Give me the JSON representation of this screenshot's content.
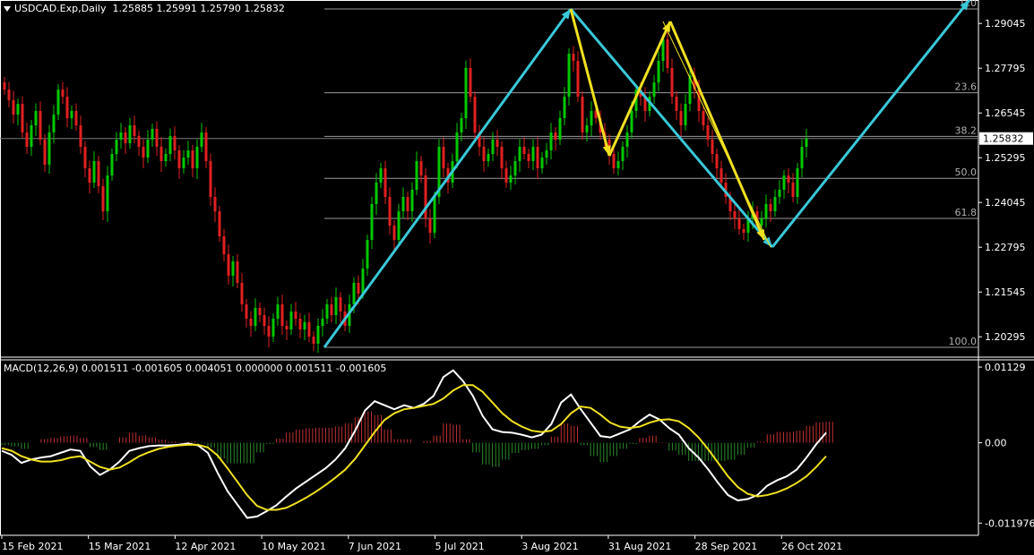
{
  "header": {
    "symbol": "USDCAD.Exp,Daily",
    "ohlc": "1.25885 1.25991 1.25790 1.25832"
  },
  "macd_header": "MACD(12,26,9) 0.001511 -0.001605 0.004051 0.000000 0.001511 -0.001605",
  "colors": {
    "background": "#000000",
    "bull_candle": "#00c800",
    "bear_candle": "#e02020",
    "fib_line": "#9a9a9a",
    "cyan_arrow": "#39c8d8",
    "yellow_arrow": "#f0e020",
    "macd_line": "#ffffff",
    "signal_line": "#f0e020",
    "hist_pos": "#c03030",
    "hist_neg": "#2a8a2a"
  },
  "chart_data": {
    "type": "candlestick",
    "price_ticks": [
      1.29045,
      1.27795,
      1.26545,
      1.25295,
      1.24045,
      1.22795,
      1.21545,
      1.20295
    ],
    "current_price": "1.25832",
    "ylim": [
      1.1975,
      1.2965
    ],
    "x_dates": [
      "15 Feb 2021",
      "15 Mar 2021",
      "12 Apr 2021",
      "10 May 2021",
      "7 Jun 2021",
      "5 Jul 2021",
      "3 Aug 2021",
      "31 Aug 2021",
      "28 Sep 2021",
      "26 Oct 2021"
    ],
    "fib_levels": [
      {
        "label": "0.0",
        "price": 1.2945
      },
      {
        "label": "23.6",
        "price": 1.2711
      },
      {
        "label": "38.2",
        "price": 1.2589
      },
      {
        "label": "50.0",
        "price": 1.2472
      },
      {
        "label": "61.8",
        "price": 1.236
      },
      {
        "label": "100.0",
        "price": 1.2
      }
    ],
    "close_series": [
      1.272,
      1.269,
      1.265,
      1.268,
      1.26,
      1.256,
      1.262,
      1.266,
      1.258,
      1.251,
      1.26,
      1.265,
      1.272,
      1.27,
      1.264,
      1.266,
      1.262,
      1.256,
      1.25,
      1.246,
      1.252,
      1.245,
      1.238,
      1.248,
      1.254,
      1.258,
      1.26,
      1.257,
      1.262,
      1.259,
      1.256,
      1.253,
      1.258,
      1.261,
      1.256,
      1.252,
      1.254,
      1.259,
      1.255,
      1.25,
      1.253,
      1.255,
      1.25,
      1.256,
      1.26,
      1.252,
      1.242,
      1.238,
      1.231,
      1.226,
      1.22,
      1.224,
      1.218,
      1.212,
      1.208,
      1.206,
      1.211,
      1.209,
      1.206,
      1.203,
      1.208,
      1.212,
      1.206,
      1.205,
      1.21,
      1.208,
      1.205,
      1.207,
      1.203,
      1.201,
      1.206,
      1.208,
      1.212,
      1.209,
      1.214,
      1.21,
      1.206,
      1.212,
      1.218,
      1.215,
      1.222,
      1.23,
      1.24,
      1.246,
      1.25,
      1.242,
      1.234,
      1.23,
      1.238,
      1.242,
      1.238,
      1.244,
      1.252,
      1.248,
      1.236,
      1.232,
      1.242,
      1.256,
      1.25,
      1.246,
      1.252,
      1.26,
      1.264,
      1.278,
      1.27,
      1.26,
      1.256,
      1.252,
      1.254,
      1.258,
      1.256,
      1.25,
      1.246,
      1.248,
      1.252,
      1.256,
      1.254,
      1.252,
      1.256,
      1.25,
      1.253,
      1.255,
      1.26,
      1.258,
      1.264,
      1.27,
      1.282,
      1.28,
      1.27,
      1.26,
      1.262,
      1.266,
      1.264,
      1.26,
      1.258,
      1.254,
      1.25,
      1.252,
      1.256,
      1.26,
      1.266,
      1.272,
      1.27,
      1.266,
      1.27,
      1.274,
      1.28,
      1.286,
      1.278,
      1.27,
      1.266,
      1.262,
      1.268,
      1.276,
      1.272,
      1.266,
      1.262,
      1.258,
      1.254,
      1.25,
      1.246,
      1.242,
      1.238,
      1.236,
      1.233,
      1.232,
      1.236,
      1.238,
      1.234,
      1.236,
      1.24,
      1.238,
      1.242,
      1.244,
      1.248,
      1.246,
      1.242,
      1.25,
      1.256,
      1.2583
    ],
    "cyan_path": [
      [
        0,
        1.2
      ],
      [
        115,
        1.2945
      ],
      [
        151,
        1.228
      ],
      [
        184,
        1.297
      ]
    ],
    "yellow_path_1": [
      [
        115,
        1.2945
      ],
      [
        121,
        1.2535
      ],
      [
        134,
        1.291
      ],
      [
        154,
        1.23
      ]
    ],
    "macd": {
      "ticks": [
        "0.01129",
        "0.00",
        "-0.011976"
      ],
      "ylim": [
        -0.0138,
        0.0125
      ],
      "macd_line": [
        -0.0012,
        -0.0018,
        -0.003,
        -0.0025,
        -0.0022,
        -0.002,
        -0.0015,
        -0.001,
        -0.0012,
        -0.0035,
        -0.0048,
        -0.004,
        -0.0028,
        -0.0012,
        -0.0008,
        -0.0005,
        -0.0004,
        -0.0004,
        -0.0003,
        -0.0001,
        -0.0004,
        -0.0015,
        -0.0045,
        -0.0072,
        -0.0092,
        -0.0112,
        -0.011,
        -0.0102,
        -0.0093,
        -0.008,
        -0.0068,
        -0.0058,
        -0.0048,
        -0.0038,
        -0.0025,
        -0.0008,
        0.0018,
        0.0048,
        0.0062,
        0.0056,
        0.005,
        0.0056,
        0.0052,
        0.0058,
        0.007,
        0.0098,
        0.0108,
        0.0092,
        0.007,
        0.004,
        0.002,
        0.0016,
        0.0015,
        0.0012,
        0.0008,
        0.0012,
        0.0028,
        0.006,
        0.0072,
        0.005,
        0.003,
        0.001,
        0.0008,
        0.0014,
        0.002,
        0.0032,
        0.0042,
        0.0035,
        0.0022,
        0.0012,
        -0.0008,
        -0.0022,
        -0.004,
        -0.006,
        -0.0078,
        -0.0086,
        -0.0084,
        -0.0078,
        -0.0064,
        -0.0056,
        -0.005,
        -0.004,
        -0.0022,
        -0.0002,
        0.0015
      ],
      "signal_line": [
        -0.0008,
        -0.0012,
        -0.002,
        -0.0025,
        -0.0028,
        -0.0028,
        -0.0026,
        -0.0022,
        -0.002,
        -0.0028,
        -0.0036,
        -0.004,
        -0.0037,
        -0.0029,
        -0.002,
        -0.0014,
        -0.0009,
        -0.0006,
        -0.0004,
        -0.0003,
        -0.0003,
        -0.0007,
        -0.0019,
        -0.0038,
        -0.0058,
        -0.0078,
        -0.0094,
        -0.01,
        -0.01,
        -0.0097,
        -0.009,
        -0.0082,
        -0.0073,
        -0.0063,
        -0.0052,
        -0.004,
        -0.0024,
        -0.0004,
        0.0016,
        0.0034,
        0.0044,
        0.005,
        0.0052,
        0.0055,
        0.0058,
        0.0066,
        0.0078,
        0.0086,
        0.0086,
        0.0076,
        0.006,
        0.0044,
        0.0032,
        0.0024,
        0.0018,
        0.0016,
        0.0018,
        0.0028,
        0.0044,
        0.0054,
        0.0052,
        0.0042,
        0.003,
        0.0024,
        0.0022,
        0.0024,
        0.003,
        0.0034,
        0.0035,
        0.0032,
        0.0022,
        0.0008,
        -0.001,
        -0.003,
        -0.005,
        -0.0066,
        -0.0076,
        -0.008,
        -0.0078,
        -0.0074,
        -0.0068,
        -0.006,
        -0.005,
        -0.0036,
        -0.002
      ]
    }
  }
}
